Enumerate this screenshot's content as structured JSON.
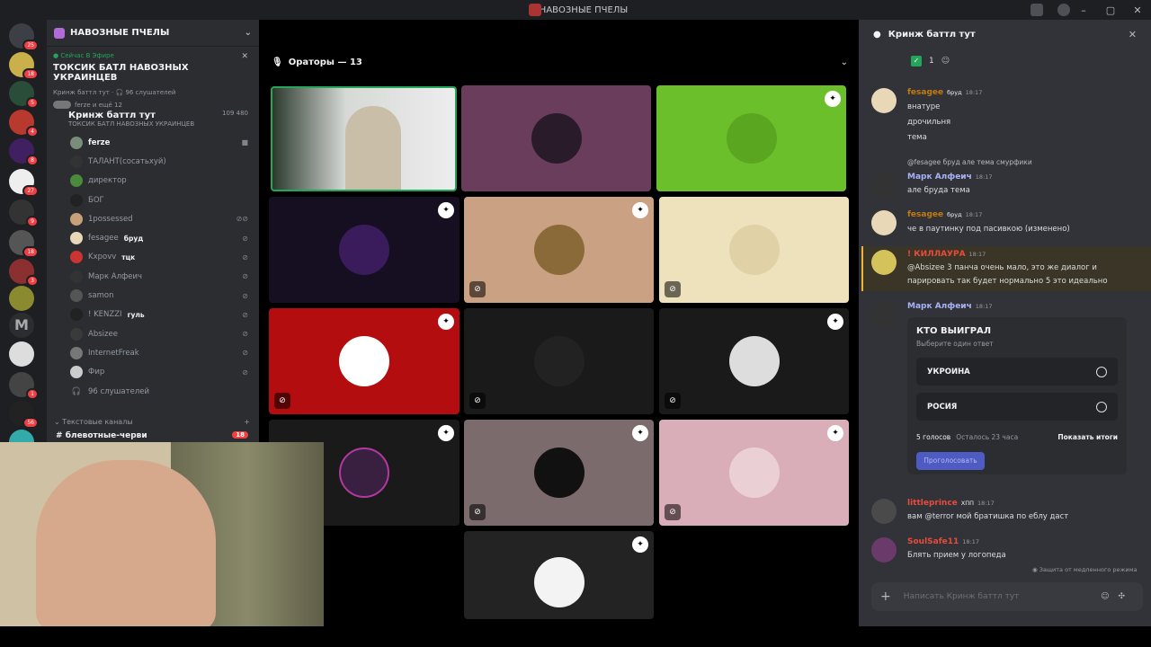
{
  "window": {
    "title": "НАВОЗНЫЕ ПЧЕЛЫ"
  },
  "server": {
    "name": "НАВОЗНЫЕ ПЧЕЛЫ"
  },
  "live": {
    "now_live": "Сейчас В Эфире",
    "stage_title": "ТОКСИК БАТЛ НАВОЗНЫХ УКРАИНЦЕВ",
    "info": "Кринж баттл тут · 🎧 96 слушателей",
    "speakers_short": "ferze и ещё 12"
  },
  "voice_channel": {
    "name": "Кринж баттл тут",
    "sub": "ТОКСИК БАТЛ НАВОЗНЫХ УКРАИНЦЕВ",
    "counts": "109 480"
  },
  "users": [
    {
      "name": "ferze",
      "tag": ""
    },
    {
      "name": "ТАЛАНТ(сосатьхуй)",
      "tag": ""
    },
    {
      "name": "директор",
      "tag": ""
    },
    {
      "name": "БОГ",
      "tag": ""
    },
    {
      "name": "1possessed",
      "tag": ""
    },
    {
      "name": "fesagee",
      "tag": "бруд"
    },
    {
      "name": "Kxpovv",
      "tag": "тцк"
    },
    {
      "name": "Марк Алфеич",
      "tag": ""
    },
    {
      "name": "samon",
      "tag": ""
    },
    {
      "name": "! KENZZI",
      "tag": "гуль"
    },
    {
      "name": "Absizee",
      "tag": ""
    },
    {
      "name": "InternetFreak",
      "tag": ""
    },
    {
      "name": "Фир",
      "tag": ""
    },
    {
      "name": "96 слушателей",
      "tag": ""
    }
  ],
  "text_category": "Текстовые каналы",
  "text_channel": {
    "name": "блевотные-черви",
    "badge": "18"
  },
  "stage": {
    "header": "Ораторы — 13"
  },
  "chat": {
    "channel": "Кринж баттл тут",
    "reaction": "1",
    "messages": [
      {
        "author": "fesagee",
        "badge": "бруд",
        "time": "18:17",
        "color": "#c27c0e",
        "lines": [
          "внатуре",
          "дрочильня",
          "тема"
        ]
      },
      {
        "reply": "@fesagee  бруд  але тема смурфики",
        "author": "Марк Алфеич",
        "badge": "",
        "time": "18:17",
        "color": "#a8b3f5",
        "lines": [
          "але бруда тема"
        ]
      },
      {
        "author": "fesagee",
        "badge": "бруд",
        "time": "18:17",
        "color": "#c27c0e",
        "lines": [
          "че в паутинку под пасивкою (изменено)"
        ]
      },
      {
        "author": "! КИЛЛАУРА",
        "badge": "",
        "time": "18:17",
        "color": "#e74c3c",
        "lines": [
          "@Absizee 3 панча очень мало, это же диалог и",
          "парировать так будет нормально 5 это идеально"
        ]
      },
      {
        "author": "Марк Алфеич",
        "badge": "",
        "time": "18:17",
        "color": "#a8b3f5",
        "lines": []
      },
      {
        "author": "littleprince",
        "badge": "ХПП",
        "time": "18:17",
        "color": "#e74c3c",
        "lines": [
          "вам @terror мой братишка по еблу даст"
        ]
      },
      {
        "author": "SoulSafe11",
        "badge": "",
        "time": "18:17",
        "color": "#e74c3c",
        "lines": [
          "Блять прием у логопеда"
        ]
      }
    ],
    "poll": {
      "question": "КТО ВЫИГРАЛ",
      "hint": "Выберите один ответ",
      "options": [
        "УКРОИНА",
        "РОСИЯ"
      ],
      "votes": "5 голосов",
      "remaining": "Осталось 23 часа",
      "show_results": "Показать итоги",
      "vote_button": "Проголосовать"
    },
    "slowmode": "Защита от медленного режима",
    "placeholder": "Написать Кринж баттл тут"
  },
  "colors": {
    "accent": "#5865f2",
    "live": "#23a55a",
    "danger": "#f23f43"
  },
  "icons": [
    "mic-icon",
    "chevron-down-icon",
    "star-icon",
    "mute-icon",
    "close-icon",
    "plus-icon",
    "emoji-icon",
    "apps-icon"
  ]
}
